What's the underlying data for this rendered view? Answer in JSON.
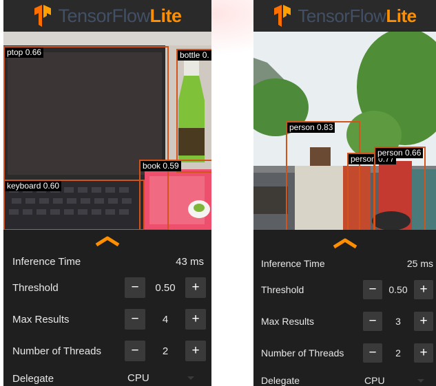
{
  "colors": {
    "brand_orange": "#FF8F00",
    "brand_slate": "#425066",
    "box_stroke": "#d3541a",
    "sheet_bg": "#1f1f1f",
    "button_bg": "#3a3a3a"
  },
  "screens": [
    {
      "app": {
        "title_main": "TensorFlow",
        "title_accent": "Lite"
      },
      "detections": [
        {
          "label": "ptop 0.66"
        },
        {
          "label": "bottle 0."
        },
        {
          "label": "book 0.59"
        },
        {
          "label": "keyboard 0.60"
        }
      ],
      "settings": {
        "inference_label": "Inference Time",
        "inference_value": "43 ms",
        "threshold_label": "Threshold",
        "threshold_value": "0.50",
        "max_results_label": "Max Results",
        "max_results_value": "4",
        "threads_label": "Number of Threads",
        "threads_value": "2",
        "delegate_label": "Delegate",
        "delegate_value": "CPU",
        "minus": "−",
        "plus": "+"
      }
    },
    {
      "app": {
        "title_main": "TensorFlow",
        "title_accent": "Lite"
      },
      "detections": [
        {
          "label": "person 0.83"
        },
        {
          "label": "person 0.77"
        },
        {
          "label": "person 0.66"
        }
      ],
      "settings": {
        "inference_label": "Inference Time",
        "inference_value": "25 ms",
        "threshold_label": "Threshold",
        "threshold_value": "0.50",
        "max_results_label": "Max Results",
        "max_results_value": "3",
        "threads_label": "Number of Threads",
        "threads_value": "2",
        "delegate_label": "Delegate",
        "delegate_value": "CPU",
        "minus": "−",
        "plus": "+"
      }
    }
  ]
}
